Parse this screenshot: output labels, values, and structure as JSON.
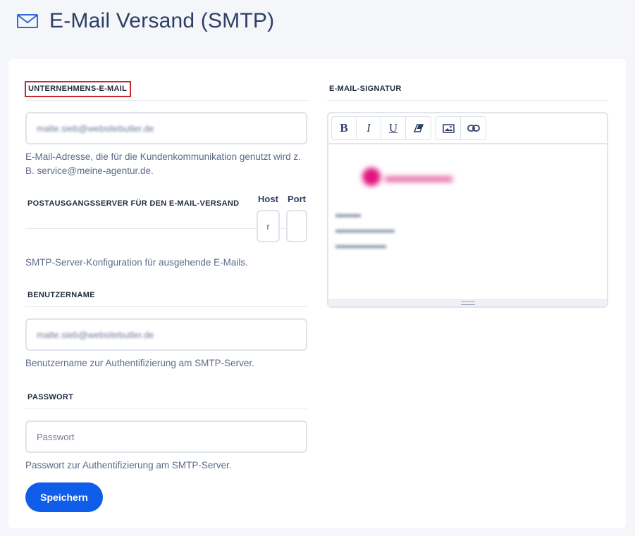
{
  "page": {
    "title": "E-Mail Versand (SMTP)"
  },
  "left": {
    "company_email": {
      "label": "UNTERNEHMENS-E-MAIL",
      "value": "malte.sieb@websitebutler.de",
      "help": "E-Mail-Adresse, die für die Kundenkommunikation genutzt wird z. B. service@meine-agentur.de."
    },
    "smtp": {
      "label": "POSTAUSGANGSSERVER FÜR DEN E-MAIL-VERSAND",
      "host_label": "Host",
      "host_value": "r",
      "port_label": "Port",
      "port_value": "",
      "help": "SMTP-Server-Konfiguration für ausgehende E-Mails."
    },
    "username": {
      "label": "BENUTZERNAME",
      "value": "malte.sieb@websitebutler.de",
      "help": "Benutzername zur Authentifizierung am SMTP-Server."
    },
    "password": {
      "label": "PASSWORT",
      "placeholder": "Passwort",
      "help": "Passwort zur Authentifizierung am SMTP-Server."
    },
    "save_label": "Speichern"
  },
  "right": {
    "signature": {
      "label": "E-MAIL-SIGNATUR",
      "toolbar": {
        "bold": "B",
        "italic": "I",
        "underline": "U"
      }
    }
  },
  "colors": {
    "accent": "#0f5de8",
    "highlight_border": "#c9282d"
  }
}
